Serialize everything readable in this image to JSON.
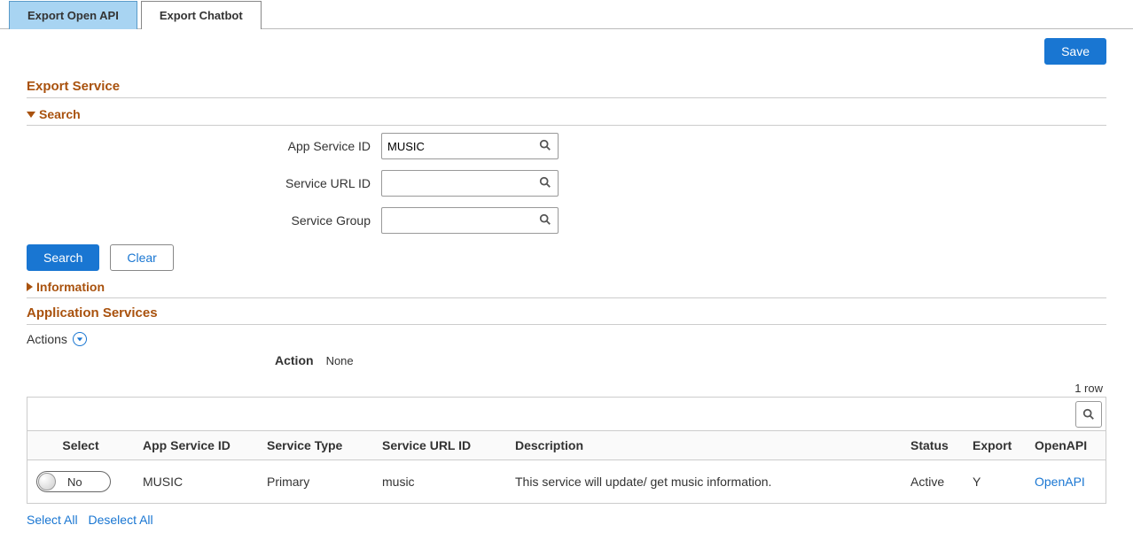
{
  "tabs": {
    "export_api": "Export Open API",
    "export_chatbot": "Export Chatbot"
  },
  "buttons": {
    "save": "Save",
    "search": "Search",
    "clear": "Clear"
  },
  "sections": {
    "export_service": "Export Service",
    "search": "Search",
    "information": "Information",
    "application_services": "Application Services"
  },
  "form": {
    "app_service_id_label": "App Service ID",
    "app_service_id_value": "MUSIC",
    "service_url_id_label": "Service URL ID",
    "service_url_id_value": "",
    "service_group_label": "Service Group",
    "service_group_value": ""
  },
  "actions": {
    "label": "Actions",
    "action_label": "Action",
    "action_value": "None"
  },
  "grid": {
    "row_count": "1 row",
    "headers": {
      "select": "Select",
      "app_service_id": "App Service ID",
      "service_type": "Service Type",
      "service_url_id": "Service URL ID",
      "description": "Description",
      "status": "Status",
      "export": "Export",
      "openapi": "OpenAPI"
    },
    "rows": [
      {
        "select": "No",
        "app_service_id": "MUSIC",
        "service_type": "Primary",
        "service_url_id": "music",
        "description": "This service will update/ get music information.",
        "status": "Active",
        "export": "Y",
        "openapi": "OpenAPI"
      }
    ]
  },
  "footer": {
    "select_all": "Select All",
    "deselect_all": "Deselect All"
  }
}
